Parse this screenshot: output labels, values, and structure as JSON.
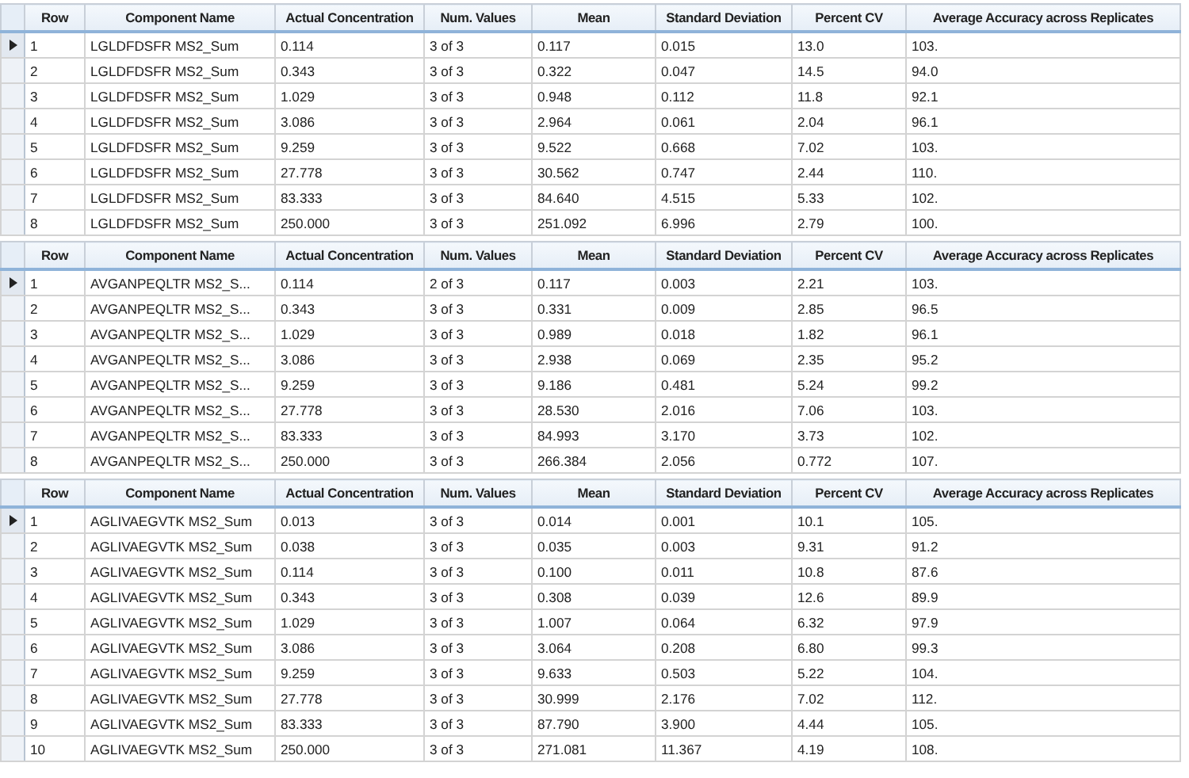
{
  "tables": [
    {
      "columns": [
        "Row",
        "Component Name",
        "Actual Concentration",
        "Num. Values",
        "Mean",
        "Standard Deviation",
        "Percent CV",
        "Average Accuracy across Replicates"
      ],
      "rows": [
        {
          "selected": true,
          "cells": [
            "1",
            "LGLDFDSFR MS2_Sum",
            "0.114",
            "3 of 3",
            "0.117",
            "0.015",
            "13.0",
            "103."
          ]
        },
        {
          "selected": false,
          "cells": [
            "2",
            "LGLDFDSFR MS2_Sum",
            "0.343",
            "3 of 3",
            "0.322",
            "0.047",
            "14.5",
            "94.0"
          ]
        },
        {
          "selected": false,
          "cells": [
            "3",
            "LGLDFDSFR MS2_Sum",
            "1.029",
            "3 of 3",
            "0.948",
            "0.112",
            "11.8",
            "92.1"
          ]
        },
        {
          "selected": false,
          "cells": [
            "4",
            "LGLDFDSFR MS2_Sum",
            "3.086",
            "3 of 3",
            "2.964",
            "0.061",
            "2.04",
            "96.1"
          ]
        },
        {
          "selected": false,
          "cells": [
            "5",
            "LGLDFDSFR MS2_Sum",
            "9.259",
            "3 of 3",
            "9.522",
            "0.668",
            "7.02",
            "103."
          ]
        },
        {
          "selected": false,
          "cells": [
            "6",
            "LGLDFDSFR MS2_Sum",
            "27.778",
            "3 of 3",
            "30.562",
            "0.747",
            "2.44",
            "110."
          ]
        },
        {
          "selected": false,
          "cells": [
            "7",
            "LGLDFDSFR MS2_Sum",
            "83.333",
            "3 of 3",
            "84.640",
            "4.515",
            "5.33",
            "102."
          ]
        },
        {
          "selected": false,
          "cells": [
            "8",
            "LGLDFDSFR MS2_Sum",
            "250.000",
            "3 of 3",
            "251.092",
            "6.996",
            "2.79",
            "100."
          ]
        }
      ]
    },
    {
      "columns": [
        "Row",
        "Component Name",
        "Actual Concentration",
        "Num. Values",
        "Mean",
        "Standard Deviation",
        "Percent CV",
        "Average Accuracy across Replicates"
      ],
      "rows": [
        {
          "selected": true,
          "cells": [
            "1",
            "AVGANPEQLTR  MS2_S...",
            "0.114",
            "2 of 3",
            "0.117",
            "0.003",
            "2.21",
            "103."
          ]
        },
        {
          "selected": false,
          "cells": [
            "2",
            "AVGANPEQLTR  MS2_S...",
            "0.343",
            "3 of 3",
            "0.331",
            "0.009",
            "2.85",
            "96.5"
          ]
        },
        {
          "selected": false,
          "cells": [
            "3",
            "AVGANPEQLTR  MS2_S...",
            "1.029",
            "3 of 3",
            "0.989",
            "0.018",
            "1.82",
            "96.1"
          ]
        },
        {
          "selected": false,
          "cells": [
            "4",
            "AVGANPEQLTR  MS2_S...",
            "3.086",
            "3 of 3",
            "2.938",
            "0.069",
            "2.35",
            "95.2"
          ]
        },
        {
          "selected": false,
          "cells": [
            "5",
            "AVGANPEQLTR  MS2_S...",
            "9.259",
            "3 of 3",
            "9.186",
            "0.481",
            "5.24",
            "99.2"
          ]
        },
        {
          "selected": false,
          "cells": [
            "6",
            "AVGANPEQLTR  MS2_S...",
            "27.778",
            "3 of 3",
            "28.530",
            "2.016",
            "7.06",
            "103."
          ]
        },
        {
          "selected": false,
          "cells": [
            "7",
            "AVGANPEQLTR  MS2_S...",
            "83.333",
            "3 of 3",
            "84.993",
            "3.170",
            "3.73",
            "102."
          ]
        },
        {
          "selected": false,
          "cells": [
            "8",
            "AVGANPEQLTR  MS2_S...",
            "250.000",
            "3 of 3",
            "266.384",
            "2.056",
            "0.772",
            "107."
          ]
        }
      ]
    },
    {
      "columns": [
        "Row",
        "Component Name",
        "Actual Concentration",
        "Num. Values",
        "Mean",
        "Standard Deviation",
        "Percent CV",
        "Average Accuracy across Replicates"
      ],
      "rows": [
        {
          "selected": true,
          "cells": [
            "1",
            "AGLIVAEGVTK MS2_Sum",
            "0.013",
            "3 of 3",
            "0.014",
            "0.001",
            "10.1",
            "105."
          ]
        },
        {
          "selected": false,
          "cells": [
            "2",
            "AGLIVAEGVTK MS2_Sum",
            "0.038",
            "3 of 3",
            "0.035",
            "0.003",
            "9.31",
            "91.2"
          ]
        },
        {
          "selected": false,
          "cells": [
            "3",
            "AGLIVAEGVTK MS2_Sum",
            "0.114",
            "3 of 3",
            "0.100",
            "0.011",
            "10.8",
            "87.6"
          ]
        },
        {
          "selected": false,
          "cells": [
            "4",
            "AGLIVAEGVTK MS2_Sum",
            "0.343",
            "3 of 3",
            "0.308",
            "0.039",
            "12.6",
            "89.9"
          ]
        },
        {
          "selected": false,
          "cells": [
            "5",
            "AGLIVAEGVTK MS2_Sum",
            "1.029",
            "3 of 3",
            "1.007",
            "0.064",
            "6.32",
            "97.9"
          ]
        },
        {
          "selected": false,
          "cells": [
            "6",
            "AGLIVAEGVTK MS2_Sum",
            "3.086",
            "3 of 3",
            "3.064",
            "0.208",
            "6.80",
            "99.3"
          ]
        },
        {
          "selected": false,
          "cells": [
            "7",
            "AGLIVAEGVTK MS2_Sum",
            "9.259",
            "3 of 3",
            "9.633",
            "0.503",
            "5.22",
            "104."
          ]
        },
        {
          "selected": false,
          "cells": [
            "8",
            "AGLIVAEGVTK MS2_Sum",
            "27.778",
            "3 of 3",
            "30.999",
            "2.176",
            "7.02",
            "112."
          ]
        },
        {
          "selected": false,
          "cells": [
            "9",
            "AGLIVAEGVTK MS2_Sum",
            "83.333",
            "3 of 3",
            "87.790",
            "3.900",
            "4.44",
            "105."
          ]
        },
        {
          "selected": false,
          "cells": [
            "10",
            "AGLIVAEGVTK MS2_Sum",
            "250.000",
            "3 of 3",
            "271.081",
            "11.367",
            "4.19",
            "108."
          ]
        }
      ]
    }
  ]
}
